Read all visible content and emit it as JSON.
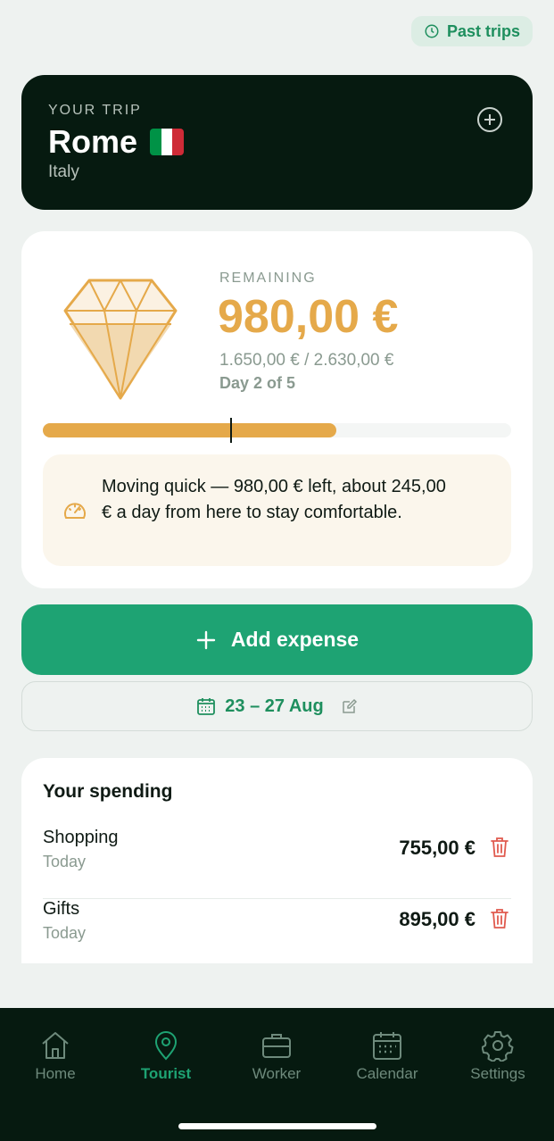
{
  "header": {
    "past_trips_label": "Past trips"
  },
  "trip": {
    "eyebrow": "YOUR TRIP",
    "city": "Rome",
    "country": "Italy",
    "flag_colors": [
      "#009246",
      "#FFFFFF",
      "#CE2B37"
    ]
  },
  "budget": {
    "remaining_label": "REMAINING",
    "remaining_value": "980,00 €",
    "spent_total": "1.650,00 € / 2.630,00 €",
    "day_count": "Day 2 of 5",
    "progress_fraction": 0.627,
    "day_fraction": 0.4,
    "advice": "Moving quick — 980,00 € left, about 245,00 € a day from here to stay comfortable."
  },
  "actions": {
    "add_expense_label": "Add expense",
    "date_range": "23 – 27 Aug"
  },
  "spending": {
    "title": "Your spending",
    "items": [
      {
        "name": "Shopping",
        "when": "Today",
        "amount": "755,00 €"
      },
      {
        "name": "Gifts",
        "when": "Today",
        "amount": "895,00 €"
      }
    ]
  },
  "tabs": [
    {
      "label": "Home",
      "icon": "home-icon"
    },
    {
      "label": "Tourist",
      "icon": "location-pin-icon"
    },
    {
      "label": "Worker",
      "icon": "briefcase-icon"
    },
    {
      "label": "Calendar",
      "icon": "calendar-icon"
    },
    {
      "label": "Settings",
      "icon": "gear-icon"
    }
  ],
  "colors": {
    "accent": "#1EA373",
    "budget_gold": "#E5A94A",
    "danger": "#E05A4E",
    "dark": "#061A10"
  }
}
